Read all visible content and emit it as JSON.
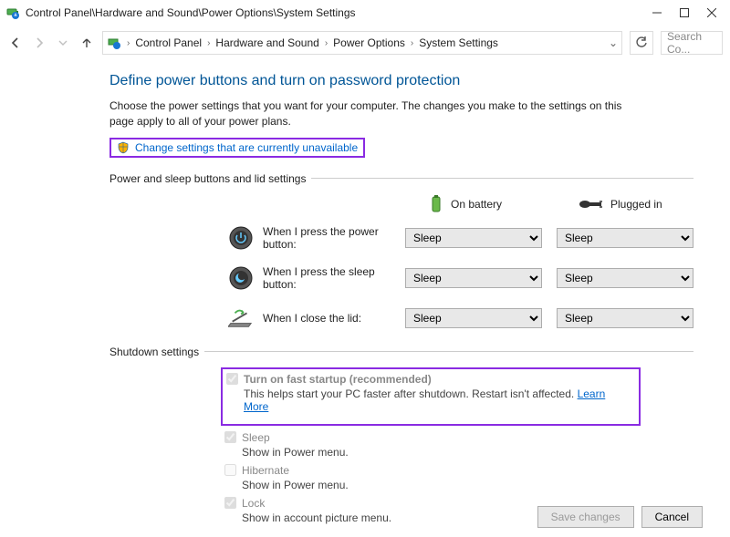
{
  "window": {
    "title_path": "Control Panel\\Hardware and Sound\\Power Options\\System Settings"
  },
  "breadcrumb": {
    "items": [
      "Control Panel",
      "Hardware and Sound",
      "Power Options",
      "System Settings"
    ]
  },
  "search": {
    "placeholder": "Search Co..."
  },
  "page": {
    "heading": "Define power buttons and turn on password protection",
    "intro": "Choose the power settings that you want for your computer. The changes you make to the settings on this page apply to all of your power plans.",
    "change_link": "Change settings that are currently unavailable"
  },
  "group1": {
    "label": "Power and sleep buttons and lid settings",
    "col_battery": "On battery",
    "col_plugged": "Plugged in",
    "rows": [
      {
        "label": "When I press the power button:",
        "battery": "Sleep",
        "plugged": "Sleep"
      },
      {
        "label": "When I press the sleep button:",
        "battery": "Sleep",
        "plugged": "Sleep"
      },
      {
        "label": "When I close the lid:",
        "battery": "Sleep",
        "plugged": "Sleep"
      }
    ]
  },
  "group2": {
    "label": "Shutdown settings",
    "items": [
      {
        "label": "Turn on fast startup (recommended)",
        "desc_prefix": "This helps start your PC faster after shutdown. Restart isn't affected. ",
        "learn_more": "Learn More",
        "checked": true,
        "bold": true
      },
      {
        "label": "Sleep",
        "desc": "Show in Power menu.",
        "checked": true
      },
      {
        "label": "Hibernate",
        "desc": "Show in Power menu.",
        "checked": false
      },
      {
        "label": "Lock",
        "desc": "Show in account picture menu.",
        "checked": true
      }
    ]
  },
  "buttons": {
    "save": "Save changes",
    "cancel": "Cancel"
  }
}
